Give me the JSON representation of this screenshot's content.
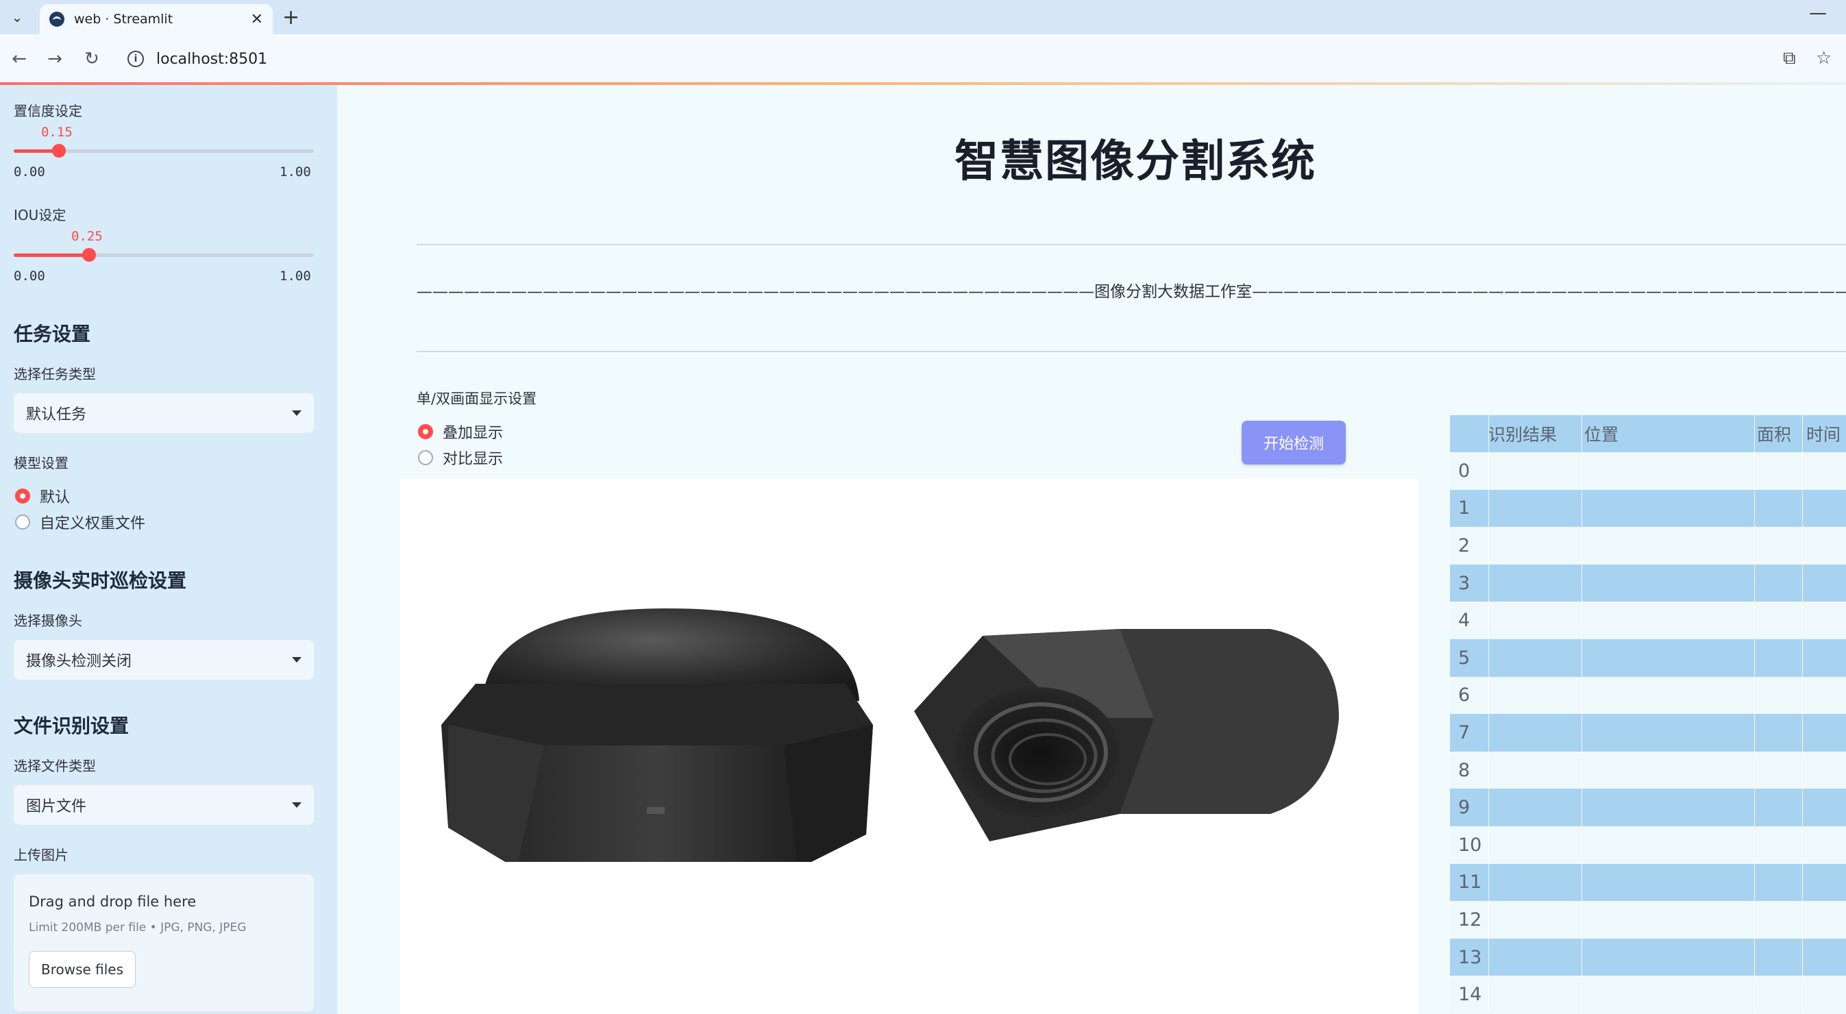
{
  "browser": {
    "tab_title": "web · Streamlit",
    "url": "localhost:8501"
  },
  "sidebar": {
    "confidence": {
      "label": "置信度设定",
      "value": "0.15",
      "min": "0.00",
      "max": "1.00",
      "fraction": 0.15
    },
    "iou": {
      "label": "IOU设定",
      "value": "0.25",
      "min": "0.00",
      "max": "1.00",
      "fraction": 0.25
    },
    "task_heading": "任务设置",
    "task_type_label": "选择任务类型",
    "task_type_value": "默认任务",
    "model_label": "模型设置",
    "model_options": [
      "默认",
      "自定义权重文件"
    ],
    "model_selected": 0,
    "camera_heading": "摄像头实时巡检设置",
    "camera_label": "选择摄像头",
    "camera_value": "摄像头检测关闭",
    "file_heading": "文件识别设置",
    "file_type_label": "选择文件类型",
    "file_type_value": "图片文件",
    "upload_label": "上传图片",
    "upload_main": "Drag and drop file here",
    "upload_sub": "Limit 200MB per file • JPG, PNG, JPEG",
    "upload_button": "Browse files"
  },
  "main": {
    "title": "智慧图像分割系统",
    "divider_text": "———————————————————————————————————————————图像分割大数据工作室———————————————————————————————————————————",
    "display_label": "单/双画面显示设置",
    "display_options": [
      "叠加显示",
      "对比显示"
    ],
    "display_selected": 0,
    "start_button": "开始检测"
  },
  "table": {
    "headers": [
      "识别结果",
      "位置",
      "面积",
      "时间"
    ],
    "row_indices": [
      "0",
      "1",
      "2",
      "3",
      "4",
      "5",
      "6",
      "7",
      "8",
      "9",
      "10",
      "11",
      "12",
      "13",
      "14"
    ]
  },
  "colors": {
    "accent": "#ff4b4b",
    "button": "#8a93f6",
    "sidebar_bg": "#d8ebf8",
    "table_stripe": "#a8d3f0"
  }
}
